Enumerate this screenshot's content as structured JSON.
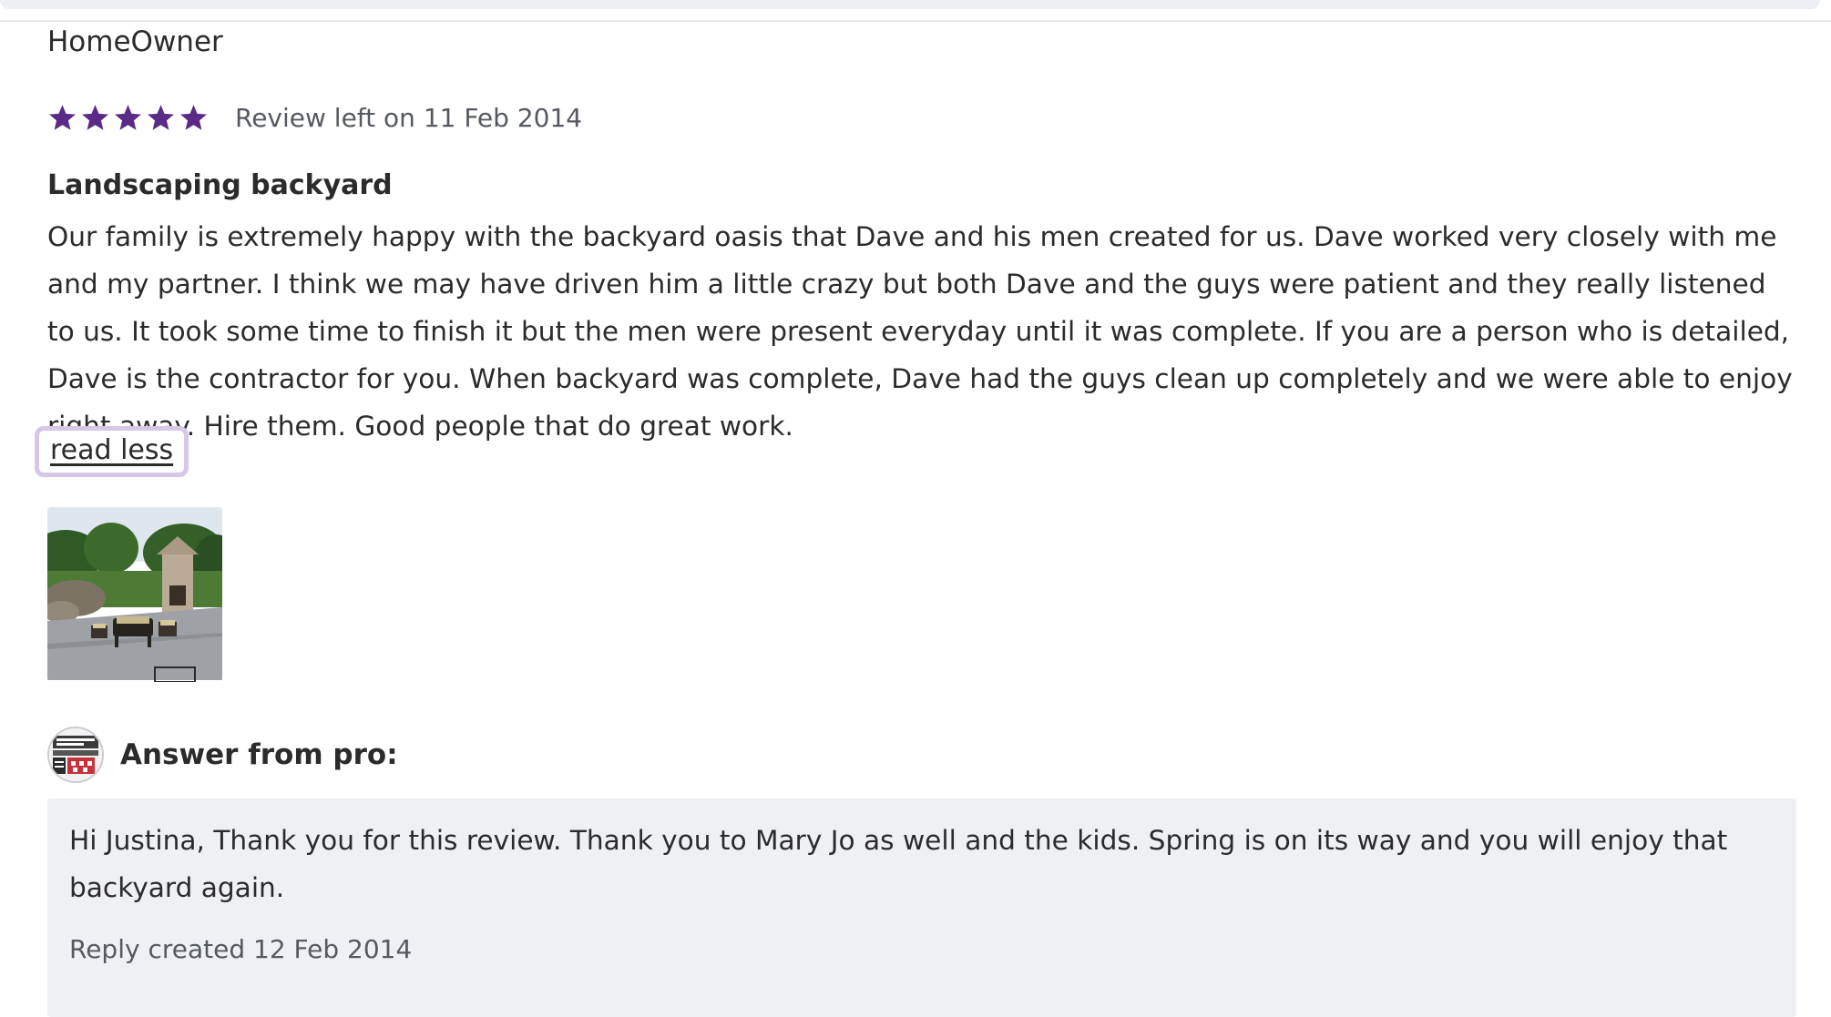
{
  "review": {
    "reviewer_name": "HomeOwner",
    "rating": 5,
    "rating_max": 5,
    "star_color": "#5b2a86",
    "date_text": "Review left on 11 Feb 2014",
    "title": "Landscaping backyard",
    "body": "Our family is extremely happy with the backyard oasis that Dave and his men created for us. Dave worked very closely with me and my partner. I think we may have driven him a little crazy but both Dave and the guys were patient and they really listened to us. It took some time to finish it but the men were present everyday until it was complete. If you are a person who is detailed, Dave is the contractor for you. When backyard was complete, Dave had the guys clean up completely and we were able to enjoy right away. Hire them. Good people that do great work.",
    "toggle_label": "read less",
    "focus_ring_color": "#d6c8e6"
  },
  "pro_answer": {
    "heading": "Answer from pro:",
    "reply_text": "Hi Justina, Thank you for this review. Thank you to Mary Jo as well and the kids. Spring is on its way and you will enjoy that backyard again.",
    "reply_date": "Reply created 12 Feb 2014",
    "box_color": "#eef0f4"
  },
  "icons": {
    "star": "star-icon",
    "photo": "review-photo-thumbnail",
    "avatar": "pro-logo-avatar"
  }
}
